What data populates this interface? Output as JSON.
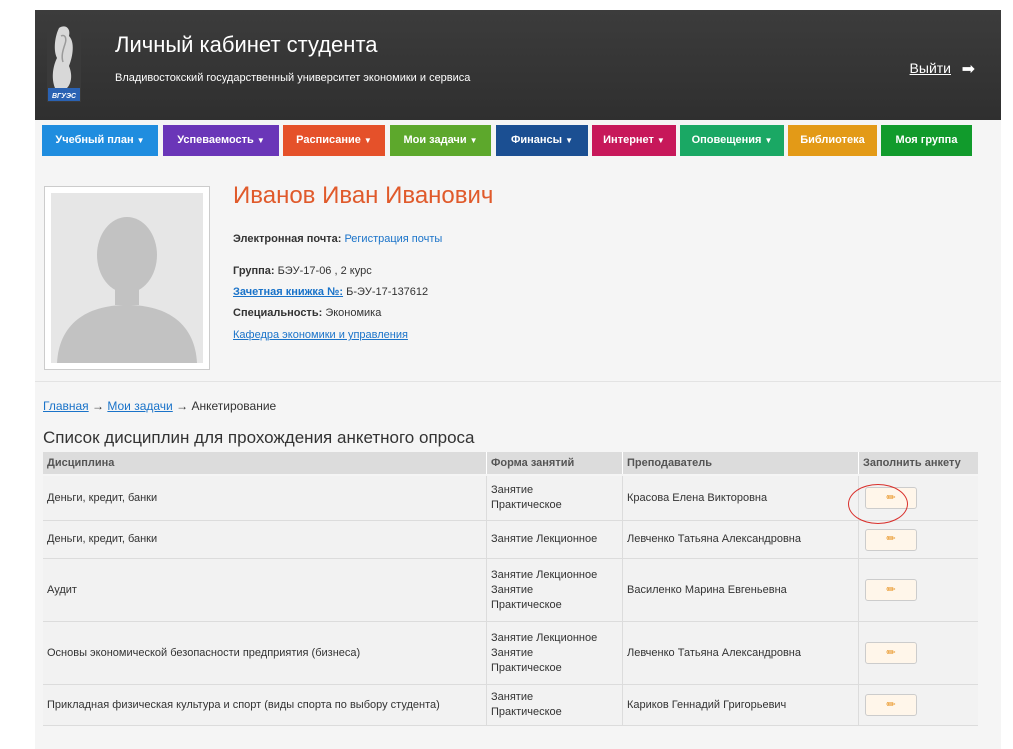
{
  "header": {
    "title": "Личный кабинет студента",
    "subtitle": "Владивостокский государственный университет экономики и сервиса",
    "logo_text": "ВГУЭС",
    "logout_label": "Выйти"
  },
  "nav": {
    "items": [
      {
        "label": "Учебный план",
        "color": "#1f8ddf"
      },
      {
        "label": "Успеваемость",
        "color": "#6a36b8"
      },
      {
        "label": "Расписание",
        "color": "#e5512a"
      },
      {
        "label": "Мои задачи",
        "color": "#5da82c"
      },
      {
        "label": "Финансы",
        "color": "#1b4f92"
      },
      {
        "label": "Интернет",
        "color": "#c7185a"
      },
      {
        "label": "Оповещения",
        "color": "#1aa864"
      },
      {
        "label": "Библиотека",
        "color": "#e39a17"
      },
      {
        "label": "Моя группа",
        "color": "#119b2c"
      }
    ]
  },
  "profile": {
    "name": "Иванов Иван Иванович",
    "email_label": "Электронная почта:",
    "email_value": "Регистрация почты",
    "group_label": "Группа:",
    "group_value": "БЭУ-17-06 , 2 курс",
    "record_label": "Зачетная книжка №:",
    "record_value": "Б-ЭУ-17-137612",
    "specialty_label": "Специальность:",
    "specialty_value": "Экономика",
    "department": "Кафедра экономики и управления"
  },
  "breadcrumb": {
    "home": "Главная",
    "tasks": "Мои задачи",
    "current": "Анкетирование",
    "separator": "→"
  },
  "section_title": "Список дисциплин для прохождения анкетного опроса",
  "table": {
    "headers": [
      "Дисциплина",
      "Форма занятий",
      "Преподаватель",
      "Заполнить анкету"
    ],
    "rows": [
      {
        "discipline": "Деньги, кредит, банки",
        "form": "Занятие Практическое",
        "teacher": "Красова Елена Викторовна"
      },
      {
        "discipline": "Деньги, кредит, банки",
        "form": "Занятие Лекционное",
        "teacher": "Левченко Татьяна Александровна"
      },
      {
        "discipline": "Аудит",
        "form": "Занятие Лекционное Занятие Практическое",
        "teacher": "Василенко Марина Евгеньевна"
      },
      {
        "discipline": "Основы экономической безопасности предприятия (бизнеса)",
        "form": "Занятие Лекционное Занятие Практическое",
        "teacher": "Левченко Татьяна Александровна"
      },
      {
        "discipline": "Прикладная физическая культура и спорт (виды спорта по выбору студента)",
        "form": "Занятие Практическое",
        "teacher": "Кариков Геннадий Григорьевич"
      }
    ]
  }
}
